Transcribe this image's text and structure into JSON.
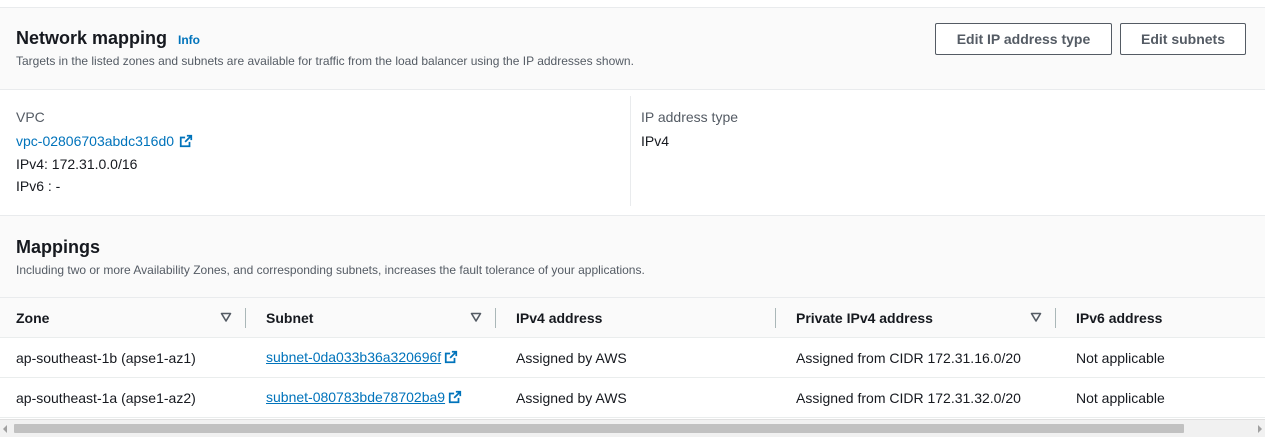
{
  "header": {
    "title": "Network mapping",
    "info_label": "Info",
    "description": "Targets in the listed zones and subnets are available for traffic from the load balancer using the IP addresses shown.",
    "edit_ip_button": "Edit IP address type",
    "edit_subnets_button": "Edit subnets"
  },
  "details": {
    "vpc_label": "VPC",
    "vpc_link": "vpc-02806703abdc316d0",
    "ipv4": "IPv4: 172.31.0.0/16",
    "ipv6": "IPv6 : -",
    "ip_type_label": "IP address type",
    "ip_type_value": "IPv4"
  },
  "mappings": {
    "title": "Mappings",
    "description": "Including two or more Availability Zones, and corresponding subnets, increases the fault tolerance of your applications.",
    "columns": [
      "Zone",
      "Subnet",
      "IPv4 address",
      "Private IPv4 address",
      "IPv6 address"
    ],
    "rows": [
      {
        "zone": "ap-southeast-1b (apse1-az1)",
        "subnet": "subnet-0da033b36a320696f",
        "ipv4": "Assigned by AWS",
        "private_ipv4": "Assigned from CIDR 172.31.16.0/20",
        "ipv6": "Not applicable"
      },
      {
        "zone": "ap-southeast-1a (apse1-az2)",
        "subnet": "subnet-080783bde78702ba9",
        "ipv4": "Assigned by AWS",
        "private_ipv4": "Assigned from CIDR 172.31.32.0/20",
        "ipv6": "Not applicable"
      }
    ]
  },
  "colors": {
    "link": "#0073bb",
    "text": "#16191f",
    "muted": "#545b64",
    "header_bg": "#fafafa"
  }
}
